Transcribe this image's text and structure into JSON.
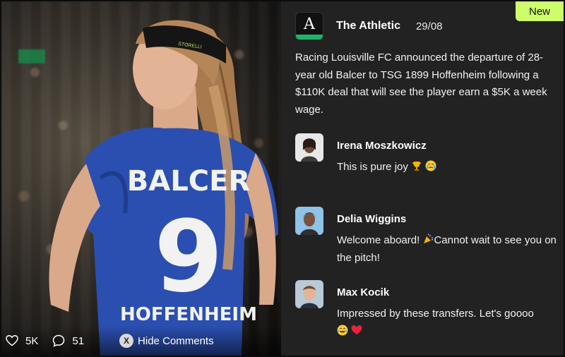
{
  "badge": "New",
  "post": {
    "source": "The Athletic",
    "logo_letter": "A",
    "date": "29/08",
    "body": "Racing Louisville FC announced the departure of 28-year old Balcer to TSG 1899 Hoffenheim following a $110K deal that will see the player earn a $5K a week wage."
  },
  "player": {
    "shirt_name": "BALCER",
    "shirt_number": "9",
    "club_text": "HOFFENHEIM",
    "headband_text": "STORELLI"
  },
  "comments": [
    {
      "name": "Irena Moszkowicz",
      "text": "This is pure joy",
      "emojis": [
        "trophy-emoji",
        "crying-face-emoji"
      ]
    },
    {
      "name": "Delia Wiggins",
      "text_before": "Welcome aboard! ",
      "text_after": "Cannot wait to see you on the pitch!",
      "emojis": [
        "party-popper-emoji"
      ]
    },
    {
      "name": "Max Kocik",
      "text": "Impressed by these transfers. Let's goooo",
      "emojis": [
        "grinning-face-emoji",
        "red-heart-emoji"
      ]
    }
  ],
  "stats": {
    "likes": "5K",
    "comments": "51"
  },
  "hide_button": {
    "key": "X",
    "label": "Hide Comments"
  },
  "colors": {
    "panel_bg": "#222222",
    "badge_bg": "#cdfd6a",
    "logo_stripe": "#1fb36a",
    "jersey": "#2a4fb0"
  }
}
